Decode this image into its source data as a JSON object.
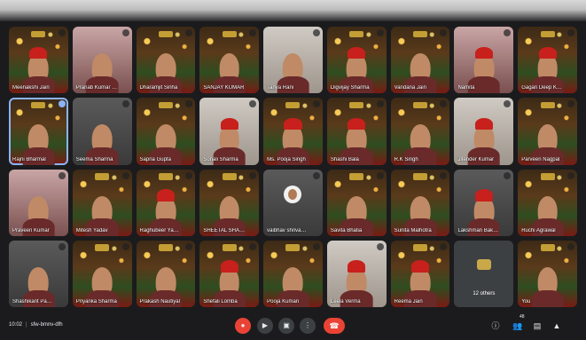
{
  "tiles": [
    {
      "name": "Meenakshi Jain",
      "style": "xmas",
      "face": "person",
      "hat": true
    },
    {
      "name": "Pranab Kumar Mit",
      "style": "pinkish",
      "face": "person",
      "hat": false
    },
    {
      "name": "Dharamjit Sinha",
      "style": "xmas",
      "face": "person",
      "hat": false
    },
    {
      "name": "SANJAY KUMAR",
      "style": "xmas",
      "face": "person",
      "hat": false
    },
    {
      "name": "Tanya Rani",
      "style": "light",
      "face": "person",
      "hat": false
    },
    {
      "name": "Digvijay Sharma",
      "style": "xmas",
      "face": "person",
      "hat": true
    },
    {
      "name": "Vandana Jain",
      "style": "xmas",
      "face": "person",
      "hat": false
    },
    {
      "name": "Namita",
      "style": "pinkish",
      "face": "person",
      "hat": true
    },
    {
      "name": "Gagan Deep Kaur",
      "style": "xmas",
      "face": "person",
      "hat": true
    },
    {
      "name": "Rajni Bharmal",
      "style": "xmas",
      "face": "person",
      "hat": false,
      "selected": true
    },
    {
      "name": "Seema Sharma",
      "style": "gray",
      "face": "person",
      "hat": false
    },
    {
      "name": "Sapna Gupta",
      "style": "xmas",
      "face": "person",
      "hat": false
    },
    {
      "name": "Sonali Sharma",
      "style": "light",
      "face": "person",
      "hat": true
    },
    {
      "name": "Ms. Pooja Singh",
      "style": "xmas",
      "face": "person",
      "hat": true
    },
    {
      "name": "Shashi Bala",
      "style": "xmas",
      "face": "person",
      "hat": true
    },
    {
      "name": "R.K Singh",
      "style": "xmas",
      "face": "person",
      "hat": false
    },
    {
      "name": "Jitender Kumar",
      "style": "light",
      "face": "person",
      "hat": true
    },
    {
      "name": "Parveen Nagpal",
      "style": "xmas",
      "face": "person",
      "hat": false
    },
    {
      "name": "Praveen Kumar",
      "style": "pinkish",
      "face": "person",
      "hat": false
    },
    {
      "name": "Mitesh Yadav",
      "style": "xmas",
      "face": "person",
      "hat": false
    },
    {
      "name": "Raghubeer Yadav",
      "style": "xmas",
      "face": "person",
      "hat": true
    },
    {
      "name": "SHEETAL SHARMA",
      "style": "xmas",
      "face": "person",
      "hat": false
    },
    {
      "name": "vaibhav shrivastava",
      "style": "gray",
      "face": "avatar",
      "hat": false
    },
    {
      "name": "Savita Bhatia",
      "style": "xmas",
      "face": "person",
      "hat": false
    },
    {
      "name": "Sunita Malhotra",
      "style": "xmas",
      "face": "person",
      "hat": false
    },
    {
      "name": "Lakshman Bakshi",
      "style": "gray",
      "face": "person",
      "hat": true
    },
    {
      "name": "Ruchi Agrawal",
      "style": "xmas",
      "face": "person",
      "hat": false
    },
    {
      "name": "Shashikant Pawar",
      "style": "gray",
      "face": "person",
      "hat": false
    },
    {
      "name": "Priyanka Sharma",
      "style": "xmas",
      "face": "person",
      "hat": false
    },
    {
      "name": "Prakash Nautiyal",
      "style": "xmas",
      "face": "person",
      "hat": false
    },
    {
      "name": "Shefali Lomba",
      "style": "xmas",
      "face": "person",
      "hat": true
    },
    {
      "name": "Pooja Kumari",
      "style": "xmas",
      "face": "person",
      "hat": false
    },
    {
      "name": "Leela Verma",
      "style": "light",
      "face": "person",
      "hat": true
    },
    {
      "name": "Reema Jain",
      "style": "xmas",
      "face": "person",
      "hat": true
    },
    {
      "name": "12 others",
      "style": "others",
      "face": "none",
      "hat": false
    },
    {
      "name": "You",
      "style": "xmas",
      "face": "person",
      "hat": false
    }
  ],
  "bottom": {
    "time": "10:02",
    "meeting_code": "sfw-bmnv-dfh"
  },
  "controls": [
    "mic-icon",
    "camera-icon",
    "present-icon",
    "more-icon"
  ],
  "right_icons": [
    "info-icon",
    "people-icon",
    "chat-icon",
    "activities-icon"
  ],
  "participants_badge": "48",
  "colors": {
    "accent": "#8ab4f8",
    "hangup": "#ea4335",
    "bar": "#1b1b1d"
  }
}
